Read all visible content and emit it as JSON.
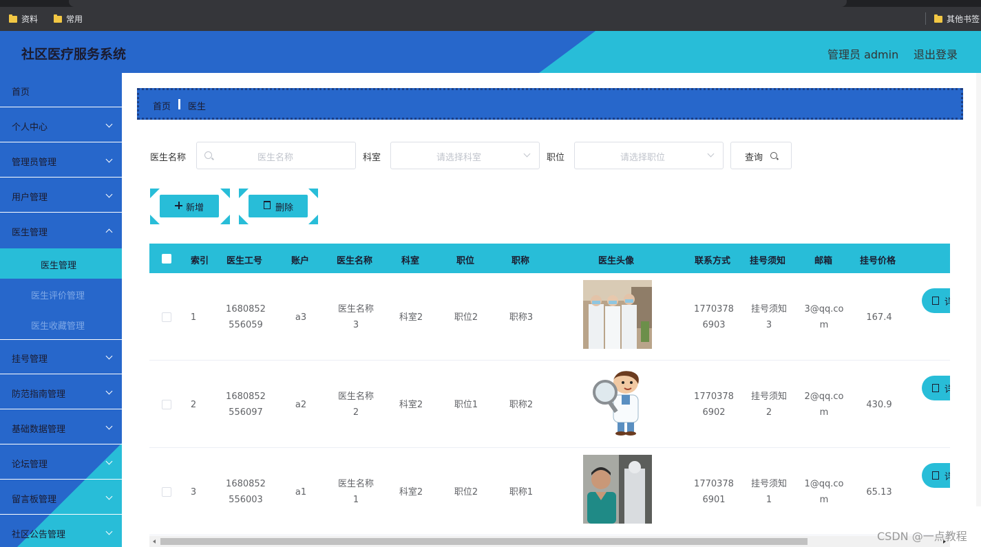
{
  "bookmarks": [
    {
      "label": "资料"
    },
    {
      "label": "常用"
    },
    {
      "label": "其他书签"
    }
  ],
  "header": {
    "title": "社区医疗服务系统",
    "admin": "管理员 admin",
    "logout": "退出登录"
  },
  "sidebar": {
    "items": [
      {
        "label": "首页"
      },
      {
        "label": "个人中心"
      },
      {
        "label": "管理员管理"
      },
      {
        "label": "用户管理"
      },
      {
        "label": "医生管理"
      },
      {
        "label": "挂号管理"
      },
      {
        "label": "防范指南管理"
      },
      {
        "label": "基础数据管理"
      },
      {
        "label": "论坛管理"
      },
      {
        "label": "留言板管理"
      },
      {
        "label": "社区公告管理"
      }
    ],
    "subitems": [
      {
        "label": "医生管理"
      },
      {
        "label": "医生评价管理"
      },
      {
        "label": "医生收藏管理"
      }
    ]
  },
  "breadcrumb": {
    "home": "首页",
    "current": "医生"
  },
  "search": {
    "name_label": "医生名称",
    "name_placeholder": "医生名称",
    "dept_label": "科室",
    "dept_placeholder": "请选择科室",
    "position_label": "职位",
    "position_placeholder": "请选择职位",
    "query_label": "查询"
  },
  "actions": {
    "add": "新增",
    "delete": "删除"
  },
  "table": {
    "headers": [
      "索引",
      "医生工号",
      "账户",
      "医生名称",
      "科室",
      "职位",
      "职称",
      "医生头像",
      "联系方式",
      "挂号须知",
      "邮箱",
      "挂号价格"
    ],
    "detail_label": "详",
    "rows": [
      {
        "index": "1",
        "id_l1": "1680852",
        "id_l2": "556059",
        "account": "a3",
        "name_l1": "医生名称",
        "name_l2": "3",
        "dept": "科室2",
        "position": "职位2",
        "title": "职称3",
        "phone_l1": "1770378",
        "phone_l2": "6903",
        "notice_l1": "挂号须知",
        "notice_l2": "3",
        "email_l1": "3@qq.co",
        "email_l2": "m",
        "price": "167.4"
      },
      {
        "index": "2",
        "id_l1": "1680852",
        "id_l2": "556097",
        "account": "a2",
        "name_l1": "医生名称",
        "name_l2": "2",
        "dept": "科室2",
        "position": "职位1",
        "title": "职称2",
        "phone_l1": "1770378",
        "phone_l2": "6902",
        "notice_l1": "挂号须知",
        "notice_l2": "2",
        "email_l1": "2@qq.co",
        "email_l2": "m",
        "price": "430.9"
      },
      {
        "index": "3",
        "id_l1": "1680852",
        "id_l2": "556003",
        "account": "a1",
        "name_l1": "医生名称",
        "name_l2": "1",
        "dept": "科室2",
        "position": "职位2",
        "title": "职称1",
        "phone_l1": "1770378",
        "phone_l2": "6901",
        "notice_l1": "挂号须知",
        "notice_l2": "1",
        "email_l1": "1@qq.co",
        "email_l2": "m",
        "price": "65.13"
      }
    ]
  },
  "watermark": "CSDN @一点教程",
  "colors": {
    "primary_blue": "#2767cb",
    "accent_cyan": "#28bdd8"
  }
}
